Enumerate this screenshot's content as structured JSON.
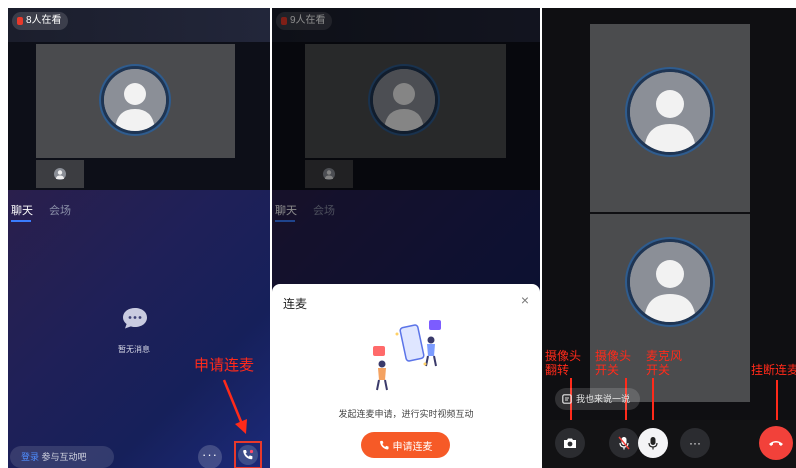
{
  "panel1": {
    "viewers": "8人在看",
    "tabs": [
      "聊天",
      "会场"
    ],
    "empty_text": "暂无消息",
    "login_link": "登录",
    "login_suffix": " 参与互动吧",
    "more": "···",
    "annotation": "申请连麦"
  },
  "panel2": {
    "viewers": "9人在看",
    "tabs": [
      "聊天",
      "会场"
    ],
    "sheet_title": "连麦",
    "close": "×",
    "description": "发起连麦申请，进行实时视频互动",
    "apply_button": "申请连麦"
  },
  "panel3": {
    "speak_placeholder": "我也来说一说",
    "more": "···",
    "annotations": {
      "camera_flip": [
        "摄像头",
        "翻转"
      ],
      "camera_toggle": [
        "摄像头",
        "开关"
      ],
      "mic_toggle": [
        "麦克风",
        "开关"
      ],
      "hangup": "挂断连麦"
    }
  },
  "colors": {
    "annotation_red": "#ff2a1a",
    "accent_orange": "#f65a27",
    "hangup_red": "#f2413a",
    "tab_underline": "#3a7cff"
  }
}
